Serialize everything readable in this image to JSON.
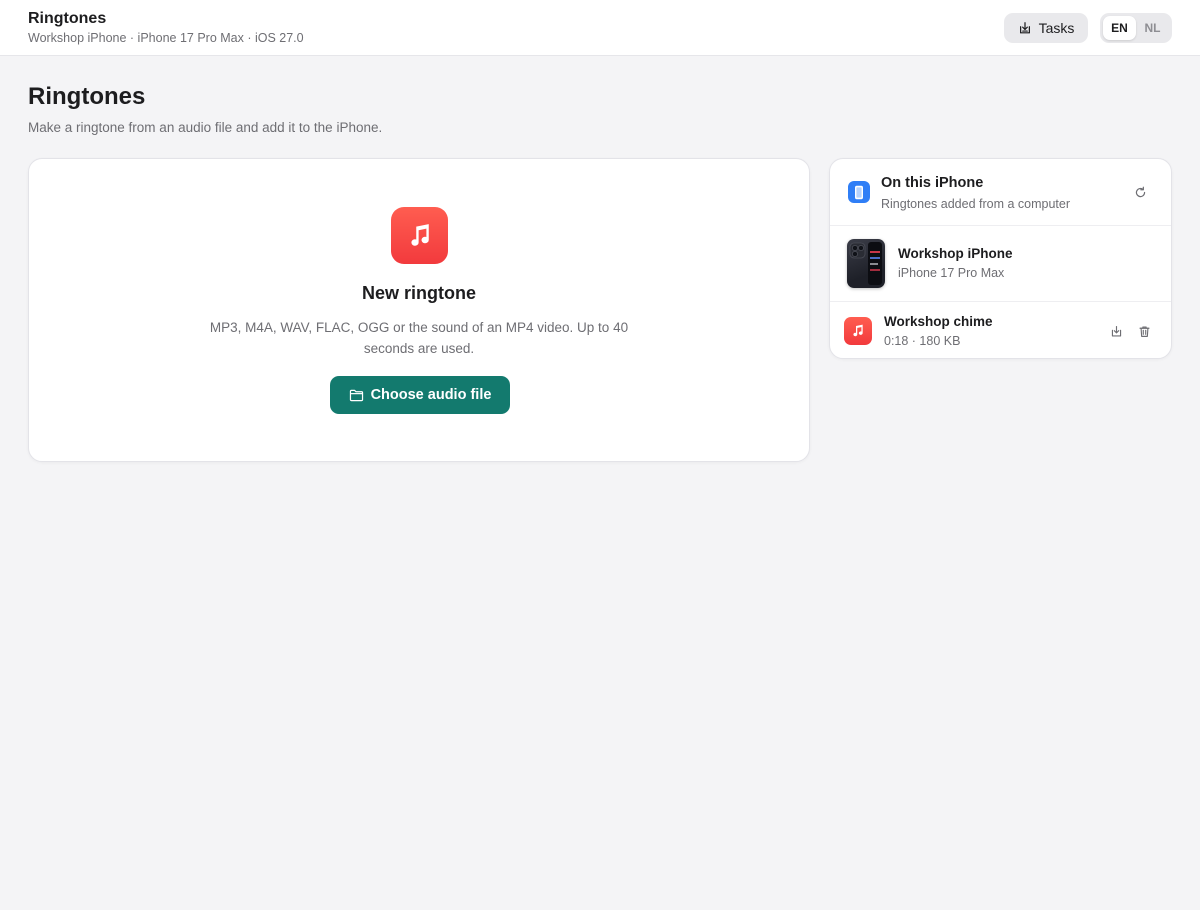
{
  "header": {
    "title": "Ringtones",
    "subtitle": "Workshop iPhone · iPhone 17 Pro Max · iOS 27.0",
    "tasks_label": "Tasks",
    "languages": [
      "EN",
      "NL"
    ],
    "active_language": "EN"
  },
  "page": {
    "title": "Ringtones",
    "description": "Make a ringtone from an audio file and add it to the iPhone."
  },
  "create": {
    "title": "New ringtone",
    "description": "MP3, M4A, WAV, FLAC, OGG or the sound of an MP4 video. Up to 40 seconds are used.",
    "button_label": "Choose audio file"
  },
  "device_panel": {
    "title": "On this iPhone",
    "subtitle": "Ringtones added from a computer",
    "device_name": "Workshop iPhone",
    "device_model": "iPhone 17 Pro Max",
    "ringtones": [
      {
        "name": "Workshop chime",
        "meta": "0:18 · 180 KB"
      }
    ]
  },
  "colors": {
    "accent_teal": "#137a6e",
    "music_red": "#f23a3d",
    "phone_blue": "#2f7ef6",
    "background": "#f4f4f6"
  },
  "icons": {
    "tasks": "download-tray-icon",
    "music": "music-note-icon",
    "folder": "folder-icon",
    "phone": "phone-icon",
    "refresh": "refresh-icon",
    "export": "export-icon",
    "delete": "trash-icon"
  }
}
